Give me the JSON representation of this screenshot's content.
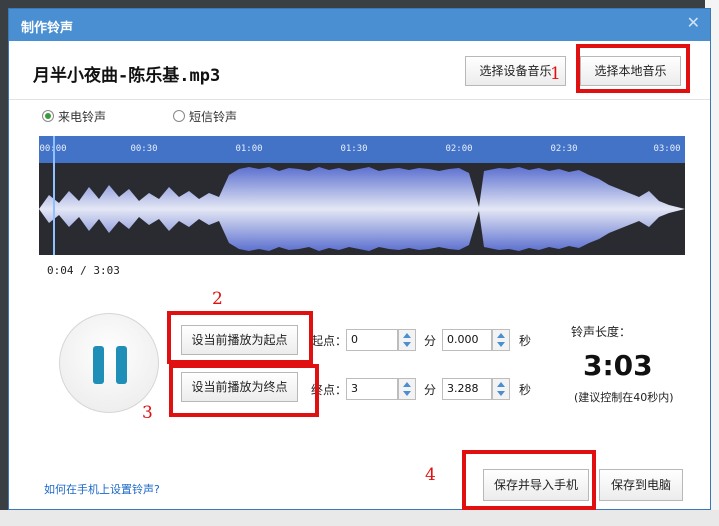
{
  "dialog": {
    "title": "制作铃声",
    "close_icon": "close-icon",
    "filename": "月半小夜曲-陈乐基.mp3"
  },
  "buttons": {
    "select_device": "选择设备音乐",
    "select_local": "选择本地音乐",
    "set_start": "设当前播放为起点",
    "set_end": "设当前播放为终点",
    "save_import": "保存并导入手机",
    "save_pc": "保存到电脑"
  },
  "ringtype": {
    "call": "来电铃声",
    "sms": "短信铃声",
    "selected": "call"
  },
  "timeline": {
    "ticks": [
      "00:00",
      "00:30",
      "01:00",
      "01:30",
      "02:00",
      "02:30",
      "03:00"
    ]
  },
  "player": {
    "position": "0:04 / 3:03",
    "pause_icon": "pause-icon"
  },
  "start": {
    "label": "起点：",
    "min": "0",
    "min_unit": "分",
    "sec": "0.000",
    "sec_unit": "秒"
  },
  "end": {
    "label": "终点：",
    "min": "3",
    "min_unit": "分",
    "sec": "3.288",
    "sec_unit": "秒"
  },
  "length": {
    "label": "铃声长度：",
    "value": "3:03",
    "hint": "(建议控制在40秒内)"
  },
  "help_link": "如何在手机上设置铃声?",
  "annotations": [
    "1",
    "2",
    "3",
    "4"
  ],
  "colors": {
    "accent": "#4a8fd2",
    "annotation_red": "#e01010",
    "wave_bg": "#2a2b30"
  }
}
